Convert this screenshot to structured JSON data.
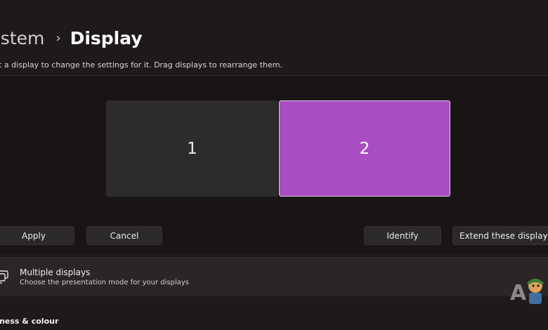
{
  "breadcrumb": {
    "parent": "ystem",
    "separator": "›",
    "current": "Display"
  },
  "instruction": "ct a display to change the settings for it. Drag displays to rearrange them.",
  "monitors": [
    {
      "label": "1",
      "selected": false
    },
    {
      "label": "2",
      "selected": true
    }
  ],
  "buttons": {
    "apply": "Apply",
    "cancel": "Cancel",
    "identify": "Identify",
    "extend_select": "Extend these displays"
  },
  "multiple_displays": {
    "title": "Multiple displays",
    "subtitle": "Choose the presentation mode for your displays",
    "icon": "multiple-displays-icon"
  },
  "section_heading": "htness & colour",
  "colors": {
    "background": "#1f1a1a",
    "panel": "#191515",
    "monitor_inactive": "#2d2c2c",
    "monitor_selected": "#a94ec2",
    "button": "#2c2929",
    "card": "#2b2525"
  }
}
